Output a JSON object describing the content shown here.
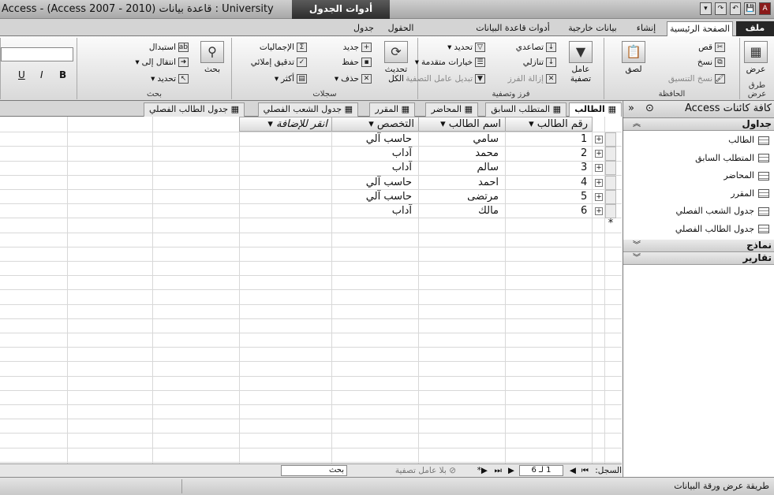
{
  "window": {
    "title": "Access - (Access 2007 - 2010) قاعدة بيانات : University",
    "context_tab": "أدوات الجدول"
  },
  "qat": [
    "A",
    "💾",
    "↶",
    "↷",
    "▾"
  ],
  "ribbon_tabs": {
    "file": "ملف",
    "home": "الصفحة الرئيسية",
    "create": "إنشاء",
    "external": "بيانات خارجية",
    "dbtools": "أدوات قاعدة البيانات",
    "fields": "الحقول",
    "table": "جدول"
  },
  "groups": {
    "views": {
      "label": "طرق عرض",
      "view": "عرض"
    },
    "clipboard": {
      "label": "الحافظة",
      "paste": "لصق",
      "cut": "قص",
      "copy": "نسخ",
      "format_painter": "نسخ التنسيق"
    },
    "sort_filter": {
      "label": "فرز وتصفية",
      "filter": "عامل تصفية",
      "ascending": "تصاعدي",
      "descending": "تنازلي",
      "remove_sort": "إزالة الفرز",
      "selection": "تحديد",
      "advanced": "خيارات متقدمة",
      "toggle_filter": "تبديل عامل التصفية"
    },
    "records": {
      "label": "سجلات",
      "refresh": "تحديث الكل",
      "new": "جديد",
      "save": "حفظ",
      "delete": "حذف",
      "totals": "الإجماليات",
      "spelling": "تدقيق إملائي",
      "more": "أكثر"
    },
    "find": {
      "label": "بحث",
      "find": "بحث",
      "replace": "استبدال",
      "goto": "انتقال إلى",
      "select": "تحديد"
    },
    "text": {
      "bold": "B",
      "italic": "I",
      "underline": "U"
    }
  },
  "doc_tabs": [
    "الطالب",
    "المتطلب السابق",
    "المحاضر",
    "المقرر",
    "جدول الشعب الفصلي",
    "جدول الطالب الفصلي"
  ],
  "datasheet": {
    "columns": [
      "رقم الطالب",
      "اسم الطالب",
      "التخصص",
      "انقر للإضافة"
    ],
    "rows": [
      {
        "id": "1",
        "name": "سامي",
        "major": "حاسب آلي"
      },
      {
        "id": "2",
        "name": "محمد",
        "major": "آداب"
      },
      {
        "id": "3",
        "name": "سالم",
        "major": "آداب"
      },
      {
        "id": "4",
        "name": "احمد",
        "major": "حاسب آلي"
      },
      {
        "id": "5",
        "name": "مرتضى",
        "major": "حاسب آلي"
      },
      {
        "id": "6",
        "name": "مالك",
        "major": "آداب"
      }
    ]
  },
  "record_nav": {
    "label": "السجل:",
    "position": "1 لـ 6",
    "no_filter": "بلا عامل تصفية",
    "search": "بحث"
  },
  "nav_pane": {
    "title": "كافة كائنات Access",
    "sections": {
      "tables": "جداول",
      "forms": "نماذج",
      "reports": "تقارير"
    },
    "tables": [
      "الطالب",
      "المتطلب السابق",
      "المحاضر",
      "المقرر",
      "جدول الشعب الفصلي",
      "جدول الطالب الفصلي"
    ]
  },
  "status": {
    "text": "طريقة عرض ورقة البيانات"
  }
}
